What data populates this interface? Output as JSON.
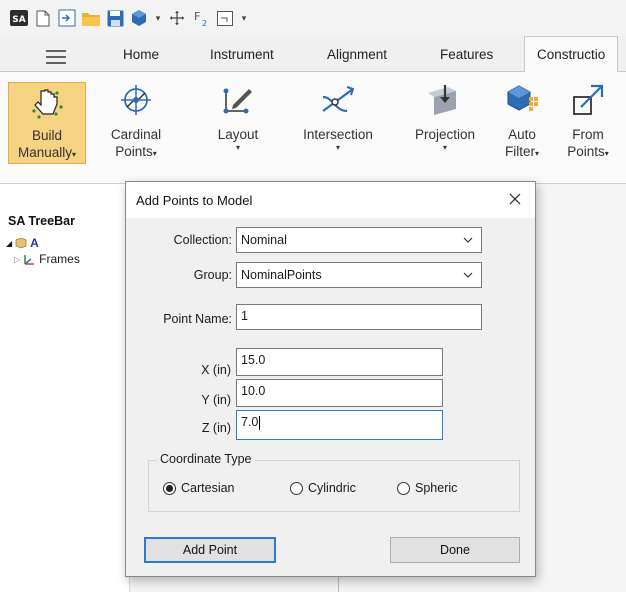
{
  "ribbon_tabs": [
    "Home",
    "Instrument",
    "Alignment",
    "Features",
    "Constructio"
  ],
  "ribbon_buttons": [
    {
      "line1": "Build",
      "line2": "Manually",
      "dropdown": true
    },
    {
      "line1": "Cardinal",
      "line2": "Points",
      "dropdown": true
    },
    {
      "line1": "Layout",
      "line2": "",
      "dropdown": true
    },
    {
      "line1": "Intersection",
      "line2": "",
      "dropdown": true
    },
    {
      "line1": "Projection",
      "line2": "",
      "dropdown": true
    },
    {
      "line1": "Auto",
      "line2": "Filter",
      "dropdown": true
    },
    {
      "line1": "From",
      "line2": "Points",
      "dropdown": true
    }
  ],
  "treebar": {
    "title": "SA TreeBar",
    "root_label": "A",
    "child_label": "Frames"
  },
  "dialog": {
    "title": "Add Points to Model",
    "collection_label": "Collection:",
    "collection_value": "Nominal",
    "group_label": "Group:",
    "group_value": "NominalPoints",
    "point_name_label": "Point Name:",
    "point_name_value": "1",
    "x_label": "X (in)",
    "x_value": "15.0",
    "y_label": "Y (in)",
    "y_value": "10.0",
    "z_label": "Z (in)",
    "z_value": "7.0",
    "coord_group_title": "Coordinate Type",
    "coord_options": [
      "Cartesian",
      "Cylindric",
      "Spheric"
    ],
    "coord_selected": "Cartesian",
    "add_point_label": "Add Point",
    "done_label": "Done"
  },
  "colors": {
    "active_button_bg": "#f6d382",
    "focus_border": "#2a7ad6"
  }
}
